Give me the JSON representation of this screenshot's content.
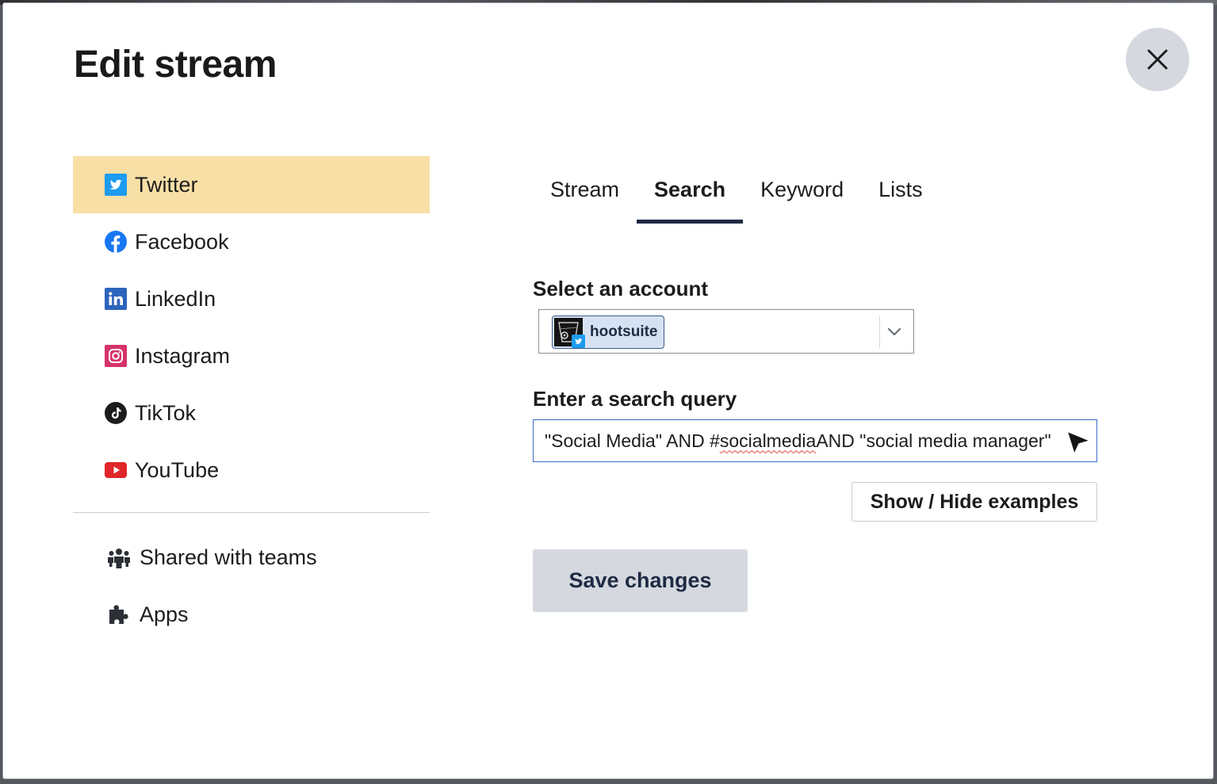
{
  "modal": {
    "title": "Edit stream"
  },
  "sidebar": {
    "networks": [
      {
        "label": "Twitter",
        "icon": "twitter-icon",
        "active": true
      },
      {
        "label": "Facebook",
        "icon": "facebook-icon"
      },
      {
        "label": "LinkedIn",
        "icon": "linkedin-icon"
      },
      {
        "label": "Instagram",
        "icon": "instagram-icon"
      },
      {
        "label": "TikTok",
        "icon": "tiktok-icon"
      },
      {
        "label": "YouTube",
        "icon": "youtube-icon"
      }
    ],
    "extras": [
      {
        "label": "Shared with teams",
        "icon": "team-icon"
      },
      {
        "label": "Apps",
        "icon": "puzzle-icon"
      }
    ]
  },
  "tabs": [
    {
      "label": "Stream"
    },
    {
      "label": "Search",
      "active": true
    },
    {
      "label": "Keyword"
    },
    {
      "label": "Lists"
    }
  ],
  "form": {
    "account_label": "Select an account",
    "account_value": "hootsuite",
    "query_label": "Enter a search query",
    "query_parts": {
      "before": "\"Social Media\" AND #",
      "flagged": "socialmedia",
      "after": " AND \"social media manager\""
    },
    "examples_button": "Show / Hide examples",
    "save_button": "Save changes"
  },
  "colors": {
    "active_item_bg": "#f8dfa6",
    "tab_underline": "#1f2a44",
    "input_focus_border": "#3b6cc8",
    "button_bg": "#d5d9df",
    "twitter": "#1d9bf0",
    "facebook": "#1877f2",
    "linkedin": "#2d64bc",
    "instagram": "#d6336c",
    "youtube": "#e0262a"
  }
}
